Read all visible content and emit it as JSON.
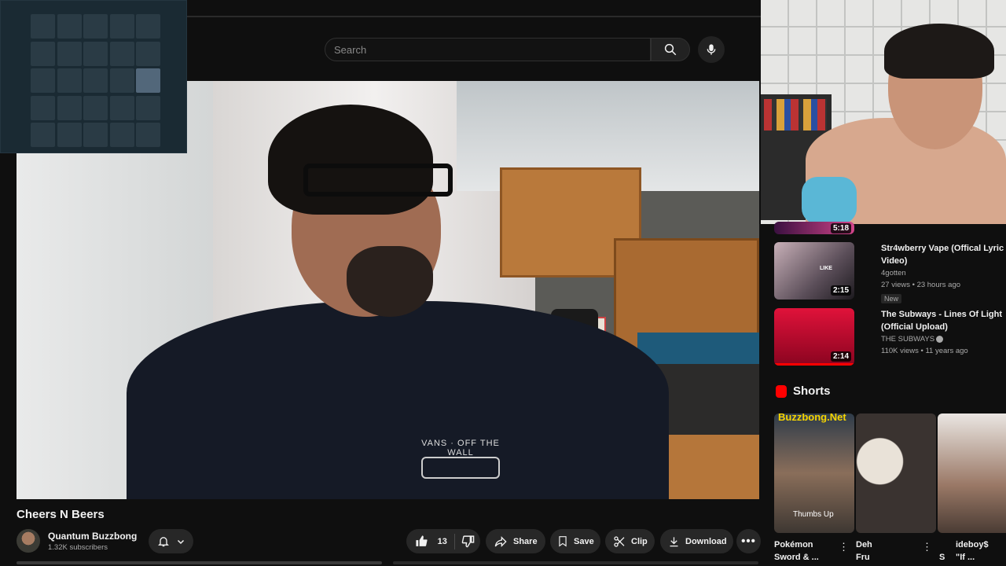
{
  "search": {
    "placeholder": "Search"
  },
  "video": {
    "title": "Cheers N Beers",
    "channel": "Quantum Buzzbong",
    "subscribers": "1.32K subscribers",
    "shirt_text": "VANS · OFF THE WALL"
  },
  "actions": {
    "likes": "13",
    "share": "Share",
    "save": "Save",
    "clip": "Clip",
    "download": "Download"
  },
  "sidebar": {
    "top_partial_duration": "5:18",
    "items": [
      {
        "title": "Str4wberry Vape (Offical Lyric Video)",
        "channel": "4gotten",
        "meta": "27 views • 23 hours ago",
        "badge": "New",
        "duration": "2:15",
        "thumb_text": "LIKE"
      },
      {
        "title": "The Subways - Lines Of Light (Official Upload)",
        "channel": "THE SUBWAYS",
        "meta": "110K views • 11 years ago",
        "duration": "2:14"
      }
    ]
  },
  "shorts": {
    "heading": "Shorts",
    "items": [
      {
        "thumb_top": "Buzzbong.Net",
        "thumb_bottom": "Thumbs Up",
        "title_line1": "Pokémon",
        "title_line2": "Sword & ..."
      },
      {
        "title_line1": "Deh",
        "title_line2": "Fru"
      },
      {
        "title_line1": "ideboy$",
        "title_line2": "\"If ..."
      }
    ],
    "partial_label": "S"
  },
  "colors": {
    "background": "#0f0f0f",
    "pill": "#272727",
    "progress": "#ff0000",
    "text_secondary": "#aaaaaa"
  },
  "grid_overlay": {
    "rows": 5,
    "cols": 5,
    "active_row": 3,
    "active_col": 5
  }
}
